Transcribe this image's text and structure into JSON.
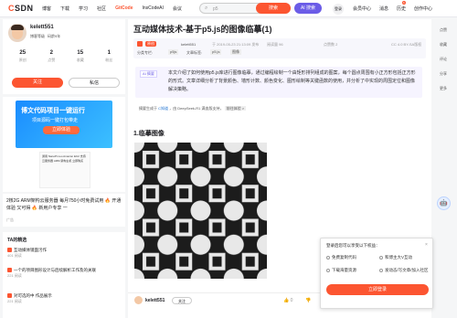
{
  "topbar": {
    "logo": "CSDN",
    "nav": [
      "博客",
      "下载",
      "学习",
      "社区",
      "GitCode",
      "InsCodeAI",
      "会议"
    ],
    "search_placeholder": "p5",
    "search_label": "搜索",
    "ai_label": "AI 搜索",
    "login_label": "登录",
    "right_nav": [
      "会员中心",
      "消息",
      "历史",
      "创作中心"
    ],
    "hot_badge": "6",
    "publish_label": "发布"
  },
  "profile": {
    "username": "kelett551",
    "level": "博客等级",
    "code_age": "码龄9年",
    "stats": [
      {
        "n": "25",
        "l": "原创"
      },
      {
        "n": "2",
        "l": "点赞"
      },
      {
        "n": "15",
        "l": "收藏"
      },
      {
        "n": "1",
        "l": "粉丝"
      }
    ],
    "follow_label": "关注",
    "message_label": "私信"
  },
  "ad1": {
    "headline": "博文代码项目一键运行",
    "sub": "项目源码一键打包带走",
    "cta": "立即体验",
    "product": "通用 NanoPi neo Amazon EC2 支持 云服务器 ARM 架构主机 立即购买"
  },
  "ad2": {
    "text": "2核2G ARM架构云服务器 每月750小时免费试用 🔥 开通体验 又可得 🔥 新用户专享 一",
    "label": "广告"
  },
  "hotlist": {
    "heading": "TA的精选",
    "items": [
      {
        "t": "互动媒体镜面污作",
        "v": "401 阅读"
      },
      {
        "t": "一个的项目图形设计与后续解析工作及的关联",
        "v": "221 阅读"
      },
      {
        "t": "对可选的中 作品展示",
        "v": "221 阅读"
      }
    ]
  },
  "article": {
    "title": "互动媒体技术-基于p5.js的图像临摹(1)",
    "badge": "原创",
    "author": "kelett551",
    "date": "于 2019-05-23 21:13:09 发布",
    "reads": "阅读量 96",
    "likes": "点赞数 2",
    "cc": "CC 4.0 BY-SA版权",
    "column_label": "分类专栏:",
    "column": "p5js",
    "tags_label": "文章标签:",
    "tags": [
      "p5.js",
      "图像"
    ],
    "summary_tag": "AI 摘要",
    "summary": "本文介绍了如何使用p5.js库进行图像临摹，通过编程绘制一个由矩形排列组成的图案，每个圆点周围有小正方形包括正方形的形式。文章详细分析了背景颜色、墙形计数、颜色变化、图形绘制等关键函数的使用，并分析了中实现的周围定位和图像解决策略。",
    "link_prefix": "摘要生成于",
    "link_text": "C知道",
    "link_suffix": "，由 DeepSeek-R1 满血版支持，",
    "link_tag": "前往体验 >",
    "heading1": "1.临摹图像",
    "author_bar": {
      "name": "kelett551",
      "follow": "关注",
      "likes": "👍 0",
      "dislikes": "👎",
      "fav": "☆ 0"
    }
  },
  "right_toolbar": [
    "点赞",
    "收藏",
    "评论",
    "分享",
    "更多"
  ],
  "popup": {
    "header": "登录后您可以享受以下权益：",
    "options": [
      "免费复制代码",
      "和博主大V互动",
      "下载海量资源",
      "发动态/写文章/加入社区"
    ],
    "button": "立即登录",
    "close": "×"
  },
  "colors": {
    "accent": "#fc5531",
    "ai": "#6b5ce7",
    "pattern_dark": "#1c1c1c",
    "pattern_light": "#e8e8e8"
  }
}
